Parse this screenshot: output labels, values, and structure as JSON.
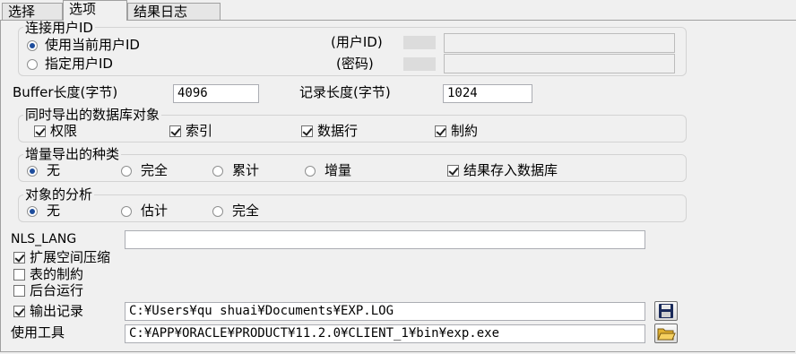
{
  "tabs": [
    "选择",
    "选项",
    "结果日志"
  ],
  "user_group": {
    "title": "连接用户ID",
    "use_current_label": "使用当前用户ID",
    "specify_label": "指定用户ID",
    "user_id_label": "(用户ID)",
    "password_label": "(密码)",
    "user_id_value": "",
    "password_value": ""
  },
  "buffer": {
    "label": "Buffer长度(字节)",
    "value": "4096"
  },
  "record": {
    "label": "记录长度(字节)",
    "value": "1024"
  },
  "objects_group": {
    "title": "同时导出的数据库对象",
    "items": [
      "权限",
      "索引",
      "数据行",
      "制約"
    ]
  },
  "incremental_group": {
    "title": "增量导出的种类",
    "options": [
      "无",
      "完全",
      "累计",
      "增量"
    ],
    "store_label": "结果存入数据库"
  },
  "analysis_group": {
    "title": "对象的分析",
    "options": [
      "无",
      "估计",
      "完全"
    ]
  },
  "nls": {
    "label": "NLS_LANG",
    "value": ""
  },
  "options": {
    "compress_label": "扩展空间压缩",
    "table_constraints_label": "表的制約",
    "background_label": "后台运行"
  },
  "output_log": {
    "label": "输出记录",
    "value": "C:¥Users¥qu shuai¥Documents¥EXP.LOG"
  },
  "tool": {
    "label": "使用工具",
    "value": "C:¥APP¥ORACLE¥PRODUCT¥11.2.0¥CLIENT_1¥bin¥exp.exe"
  },
  "icons": {
    "save": "floppy-disk-icon",
    "open": "folder-open-icon"
  }
}
